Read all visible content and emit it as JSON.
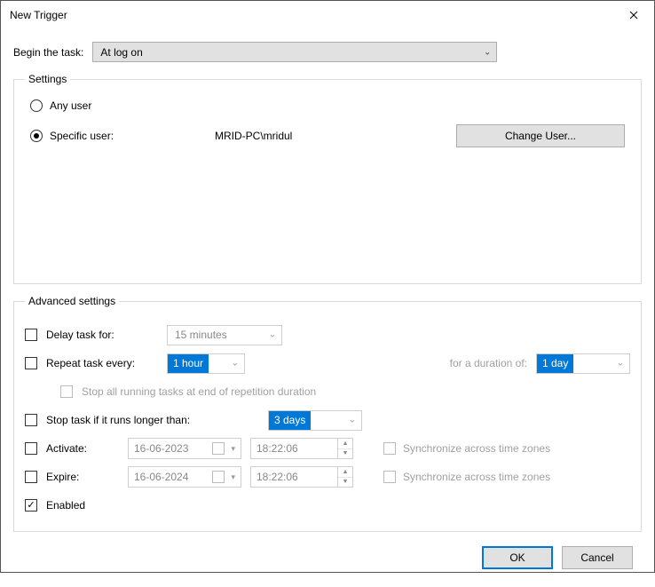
{
  "window": {
    "title": "New Trigger"
  },
  "begin": {
    "label": "Begin the task:",
    "selected": "At log on"
  },
  "settings": {
    "legend": "Settings",
    "any_user": "Any user",
    "specific_user": "Specific user:",
    "user_value": "MRID-PC\\mridul",
    "change_user": "Change User..."
  },
  "advanced": {
    "legend": "Advanced settings",
    "delay_label": "Delay task for:",
    "delay_value": "15 minutes",
    "repeat_label": "Repeat task every:",
    "repeat_value": "1 hour",
    "duration_label": "for a duration of:",
    "duration_value": "1 day",
    "stop_all_label": "Stop all running tasks at end of repetition duration",
    "stop_if_label": "Stop task if it runs longer than:",
    "stop_if_value": "3 days",
    "activate_label": "Activate:",
    "activate_date": "16-06-2023",
    "activate_time": "18:22:06",
    "expire_label": "Expire:",
    "expire_date": "16-06-2024",
    "expire_time": "18:22:06",
    "sync_label": "Synchronize across time zones",
    "enabled_label": "Enabled"
  },
  "footer": {
    "ok": "OK",
    "cancel": "Cancel"
  }
}
